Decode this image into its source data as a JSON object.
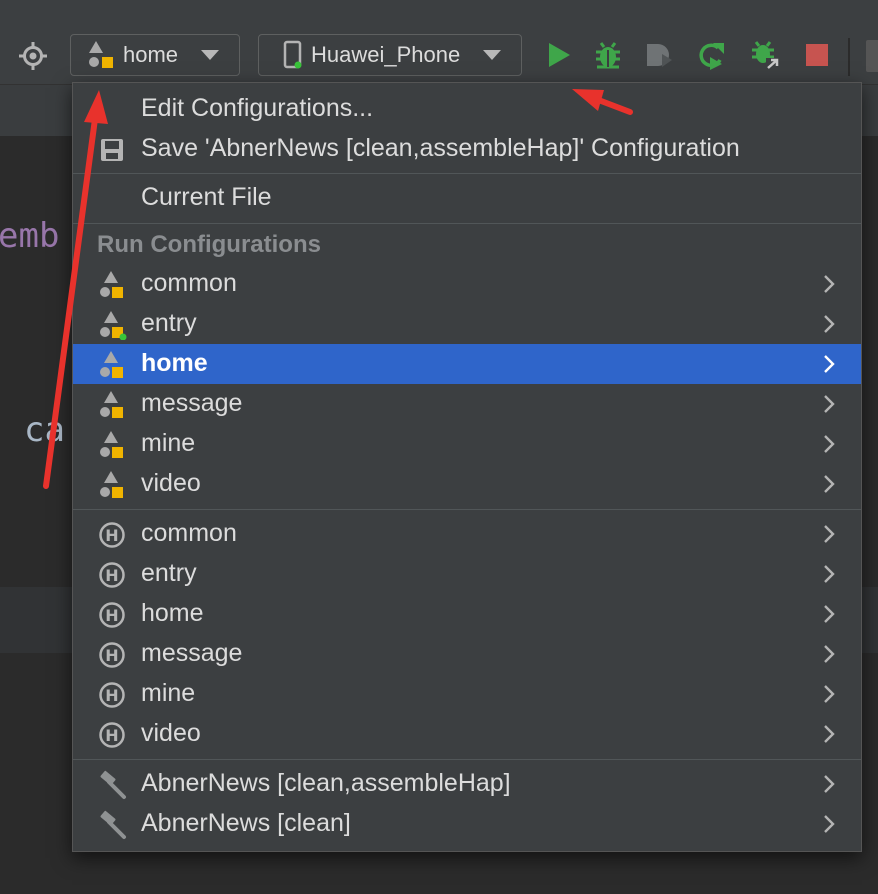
{
  "toolbar": {
    "config_combo": {
      "label": "home",
      "icon": "module-config-icon"
    },
    "device_combo": {
      "label": "Huawei_Phone",
      "icon": "phone-icon"
    },
    "actions": [
      "target-icon",
      "run-icon",
      "debug-icon",
      "profile-icon",
      "apply-changes-icon",
      "attach-debugger-icon",
      "stop-icon"
    ]
  },
  "editor": {
    "fragment_1": "emb",
    "fragment_2": "ca"
  },
  "menu": {
    "edit_configurations": "Edit Configurations...",
    "save_configuration": "Save 'AbnerNews [clean,assembleHap]' Configuration",
    "current_file": "Current File",
    "run_configurations_header": "Run Configurations",
    "module_items": [
      {
        "label": "common",
        "icon": "module-config-icon"
      },
      {
        "label": "entry",
        "icon": "module-config-active-icon"
      },
      {
        "label": "home",
        "icon": "module-config-icon",
        "selected": true
      },
      {
        "label": "message",
        "icon": "module-config-icon"
      },
      {
        "label": "mine",
        "icon": "module-config-icon"
      },
      {
        "label": "video",
        "icon": "module-config-icon"
      }
    ],
    "hap_items": [
      {
        "label": "common",
        "icon": "hap-h-icon"
      },
      {
        "label": "entry",
        "icon": "hap-h-icon"
      },
      {
        "label": "home",
        "icon": "hap-h-icon"
      },
      {
        "label": "message",
        "icon": "hap-h-icon"
      },
      {
        "label": "mine",
        "icon": "hap-h-icon"
      },
      {
        "label": "video",
        "icon": "hap-h-icon"
      }
    ],
    "task_items": [
      {
        "label": "AbnerNews [clean,assembleHap]",
        "icon": "hammer-icon"
      },
      {
        "label": "AbnerNews [clean]",
        "icon": "hammer-icon"
      }
    ]
  },
  "colors": {
    "selection": "#2f65ca",
    "run_green": "#3fa64a",
    "stop_red": "#c75450",
    "arrow_red": "#e8322c",
    "purple_code": "#9876aa"
  }
}
